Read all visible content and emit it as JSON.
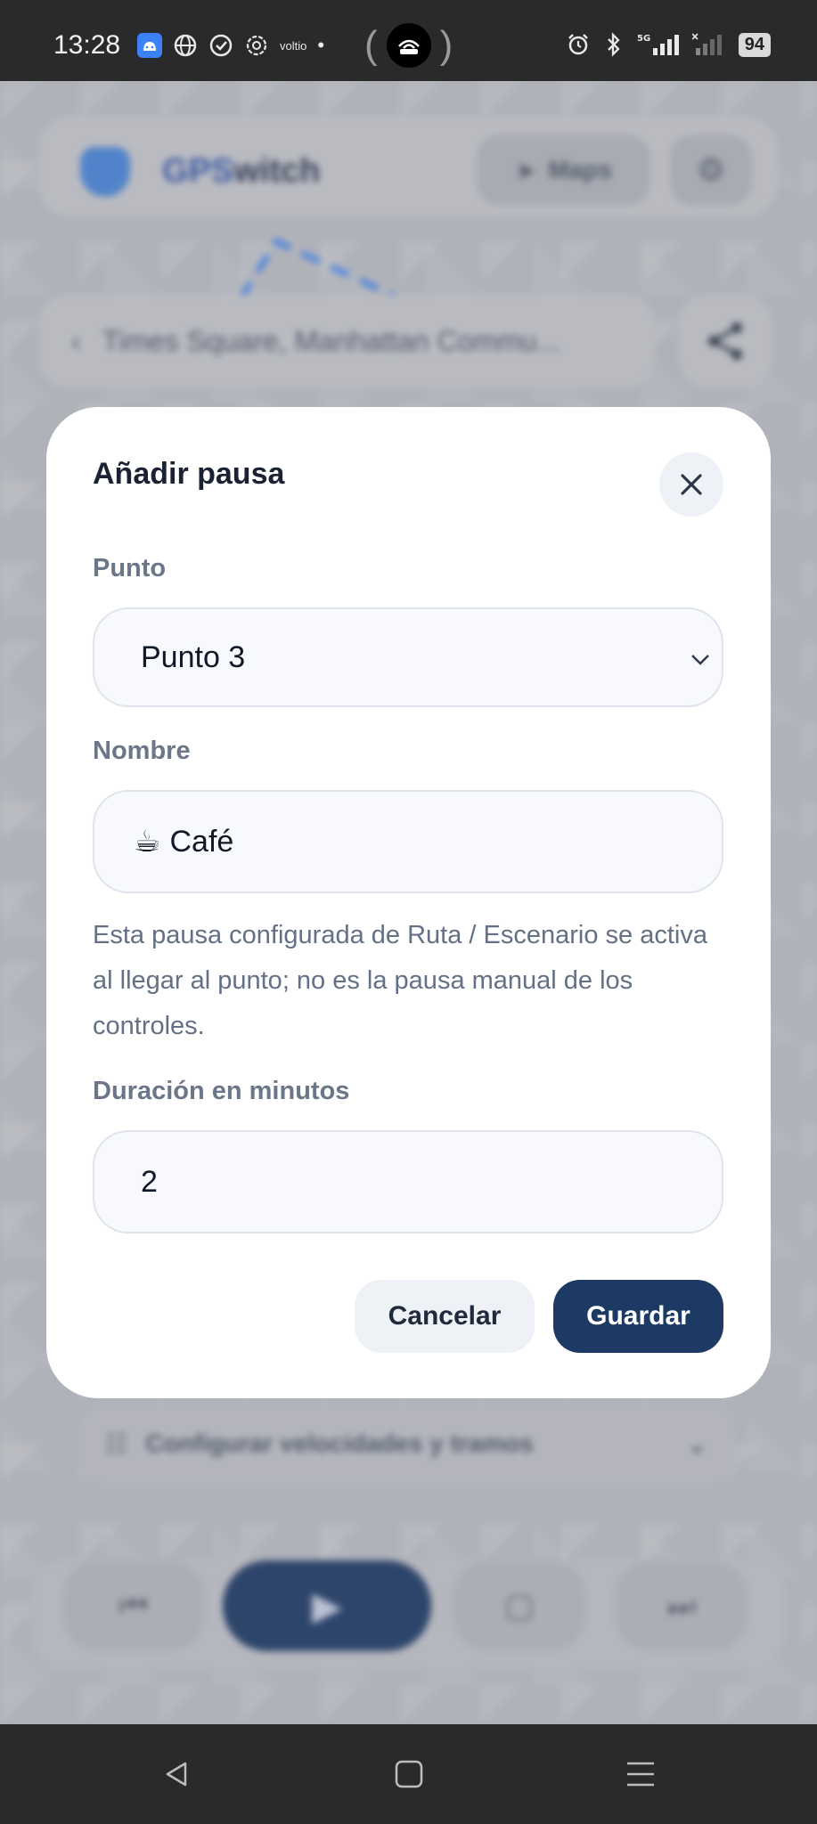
{
  "status_bar": {
    "time": "13:28",
    "left_icons": [
      "android-icon",
      "globe-icon",
      "check-circle-icon",
      "openai-icon"
    ],
    "carrier_text": "voltio",
    "dot": "•",
    "network": "5G",
    "battery": "94"
  },
  "background": {
    "brand_part1": "GPS",
    "brand_part2": "witch",
    "maps_label": "Maps",
    "search_text": "Times Square, Manhattan Commu...",
    "config_label": "Configurar velocidades y tramos"
  },
  "modal": {
    "title": "Añadir pausa",
    "point_label": "Punto",
    "point_value": "Punto 3",
    "name_label": "Nombre",
    "name_emoji": "☕",
    "name_value": "Café",
    "help_text": "Esta pausa configurada de Ruta / Escenario se activa al llegar al punto; no es la pausa manual de los controles.",
    "duration_label": "Duración en minutos",
    "duration_value": "2",
    "cancel_label": "Cancelar",
    "save_label": "Guardar"
  },
  "colors": {
    "primary": "#1c3a63",
    "label": "#6b7689",
    "field_bg": "#f7f9fc"
  }
}
